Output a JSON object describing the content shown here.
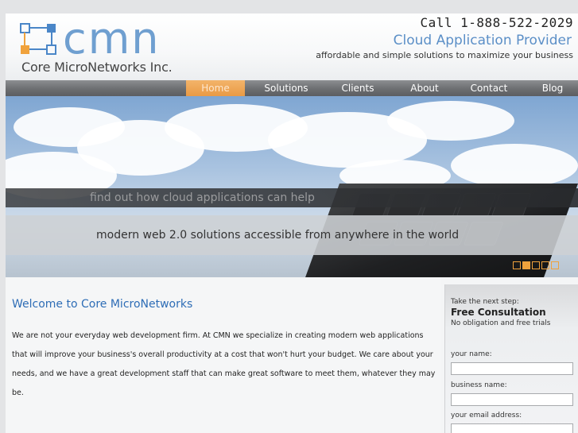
{
  "brand": {
    "logo_text": "cmn",
    "company": "Core MicroNetworks Inc.",
    "phone": "Call 1-888-522-2029",
    "tagline": "Cloud Application Provider",
    "tagline_sub": "affordable and simple solutions to maximize your business",
    "accent_color": "#6f9fd0",
    "highlight_color": "#f0a23c"
  },
  "nav": {
    "items": [
      {
        "label": "Home",
        "active": true
      },
      {
        "label": "Solutions"
      },
      {
        "label": "Clients"
      },
      {
        "label": "About"
      },
      {
        "label": "Contact"
      },
      {
        "label": "Blog"
      }
    ]
  },
  "banner": {
    "line1": "find out how cloud applications can help",
    "line2": "modern web 2.0 solutions accessible from anywhere in the world",
    "slides": 5,
    "current_slide": 2
  },
  "main": {
    "title": "Welcome to Core MicroNetworks",
    "paragraph": "We are not your everyday web development firm. At CMN we specialize in creating modern web applications that will improve your business's overall productivity at a cost that won't hurt your budget. We care about your needs, and we have a great development staff that can make great software to meet them, whatever they may be."
  },
  "sidebar": {
    "kicker": "Take the next step:",
    "heading": "Free Consultation",
    "sub": "No obligation and free trials",
    "fields": [
      {
        "label": "your name:",
        "value": ""
      },
      {
        "label": "business name:",
        "value": ""
      },
      {
        "label": "your email address:",
        "value": ""
      }
    ]
  }
}
